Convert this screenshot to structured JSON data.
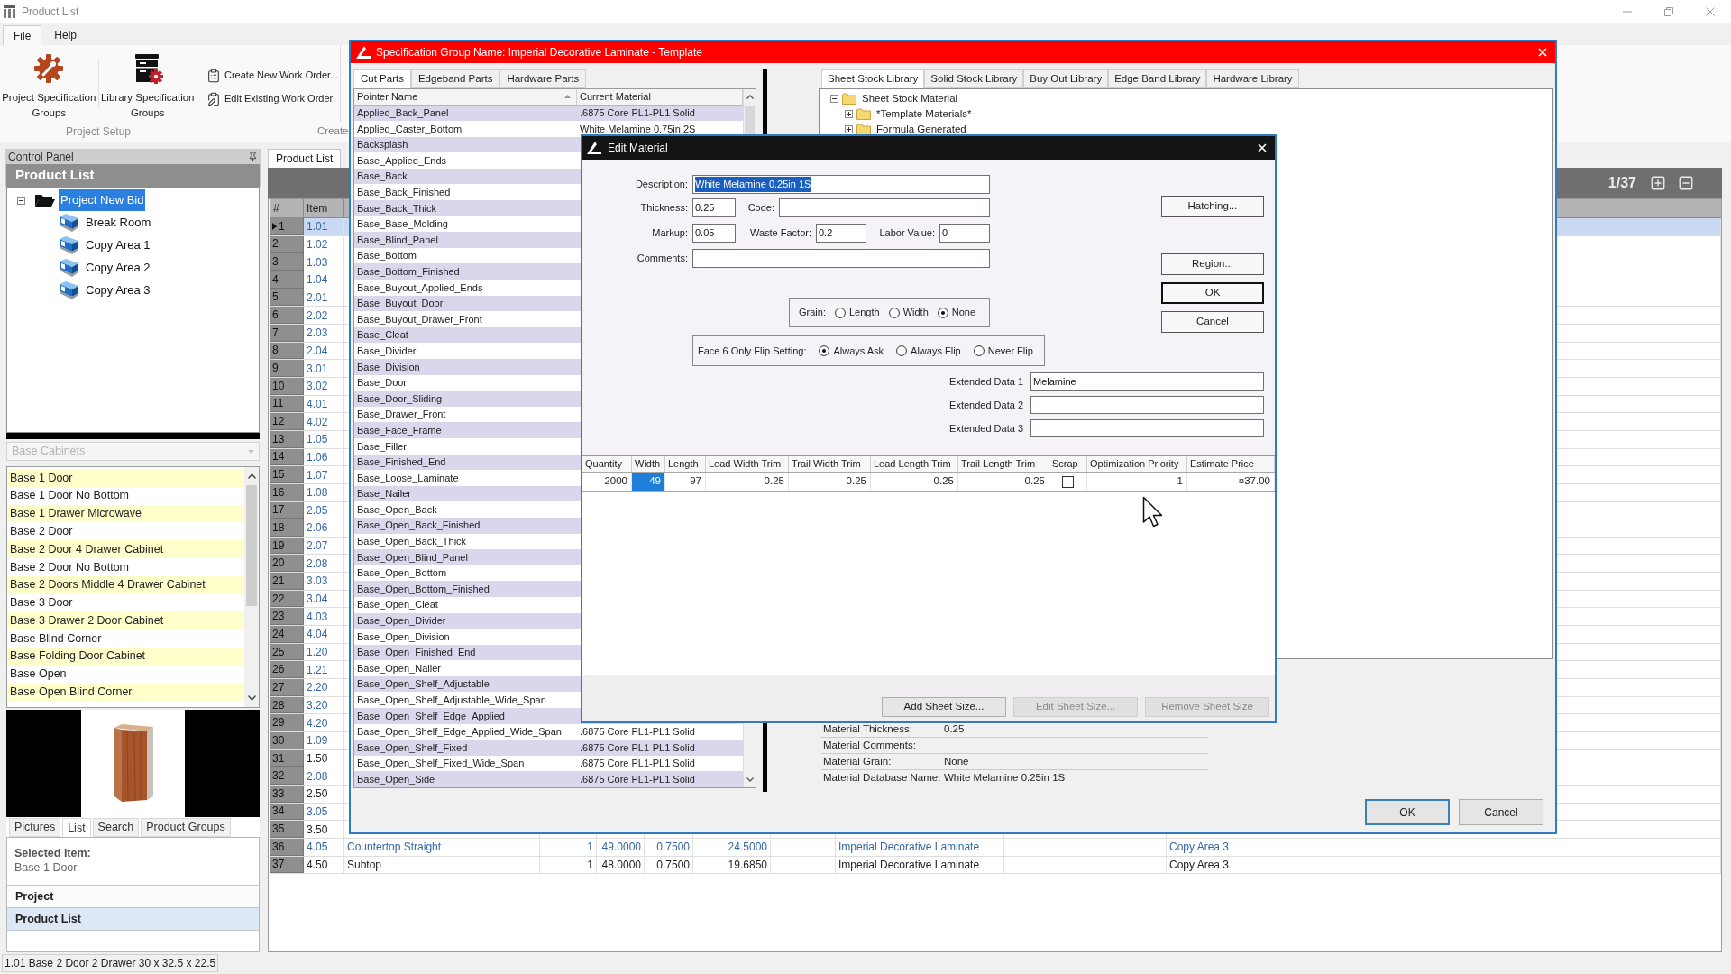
{
  "window": {
    "title": "Product List"
  },
  "menu_tabs": [
    {
      "label": "File",
      "selected": true
    },
    {
      "label": "Help",
      "selected": false
    }
  ],
  "ribbon": {
    "groups": [
      {
        "label": "Project Setup",
        "kind": "large",
        "buttons": [
          {
            "label": "Project Specification Groups"
          },
          {
            "label": "Library Specification Groups"
          }
        ]
      },
      {
        "label": "Create",
        "kind": "small",
        "buttons": [
          {
            "label": "Create New Work Order..."
          },
          {
            "label": "Edit Existing Work Order"
          }
        ]
      }
    ]
  },
  "control_panel": {
    "title": "Control Panel",
    "header": "Product List",
    "tree": {
      "label": "Project New Bid",
      "selected": true,
      "expanded": true,
      "children": [
        {
          "label": "Break Room",
          "selected": false
        },
        {
          "label": "Copy Area 1",
          "selected": false
        },
        {
          "label": "Copy Area 2",
          "selected": false
        },
        {
          "label": "Copy Area 3",
          "selected": false
        }
      ]
    },
    "category": {
      "value": "Base Cabinets",
      "disabled": true
    },
    "products": [
      "Base 1 Door",
      "Base 1 Door No Bottom",
      "Base 1 Drawer Microwave",
      "Base 2 Door",
      "Base 2 Door 4 Drawer Cabinet",
      "Base 2 Door No Bottom",
      "Base 2 Doors Middle 4 Drawer Cabinet",
      "Base 3 Door",
      "Base 3 Drawer 2 Door Cabinet",
      "Base Blind Corner",
      "Base Folding Door Cabinet",
      "Base Open",
      "Base Open Blind Corner"
    ],
    "view_tabs": [
      {
        "label": "Pictures",
        "selected": false
      },
      {
        "label": "List",
        "selected": true
      },
      {
        "label": "Search",
        "selected": false
      },
      {
        "label": "Product Groups",
        "selected": false
      }
    ],
    "selected_item": {
      "label": "Selected Item:",
      "value": "Base 1 Door"
    },
    "sections": [
      {
        "label": "Project",
        "selected": false
      },
      {
        "label": "Product List",
        "selected": true
      }
    ]
  },
  "main": {
    "tabs": [
      {
        "label": "Product List",
        "selected": true
      }
    ],
    "page": "1/37",
    "columns": [
      "#",
      "Item"
    ],
    "rows": [
      {
        "number": "1",
        "item": "1.01",
        "color": "#3565a5",
        "selected": true
      },
      {
        "number": "2",
        "item": "1.02",
        "color": "#3565a5",
        "selected": false
      },
      {
        "number": "3",
        "item": "1.03",
        "color": "#3565a5",
        "selected": false
      },
      {
        "number": "4",
        "item": "1.04",
        "color": "#3565a5",
        "selected": false
      },
      {
        "number": "5",
        "item": "2.01",
        "color": "#3565a5",
        "selected": false
      },
      {
        "number": "6",
        "item": "2.02",
        "color": "#3565a5",
        "selected": false
      },
      {
        "number": "7",
        "item": "2.03",
        "color": "#3565a5",
        "selected": false
      },
      {
        "number": "8",
        "item": "2.04",
        "color": "#3565a5",
        "selected": false
      },
      {
        "number": "9",
        "item": "3.01",
        "color": "#3565a5",
        "selected": false
      },
      {
        "number": "10",
        "item": "3.02",
        "color": "#3565a5",
        "selected": false
      },
      {
        "number": "11",
        "item": "4.01",
        "color": "#3565a5",
        "selected": false
      },
      {
        "number": "12",
        "item": "4.02",
        "color": "#3565a5",
        "selected": false
      },
      {
        "number": "13",
        "item": "1.05",
        "color": "#3565a5",
        "selected": false
      },
      {
        "number": "14",
        "item": "1.06",
        "color": "#3565a5",
        "selected": false
      },
      {
        "number": "15",
        "item": "1.07",
        "color": "#3565a5",
        "selected": false
      },
      {
        "number": "16",
        "item": "1.08",
        "color": "#3565a5",
        "selected": false
      },
      {
        "number": "17",
        "item": "2.05",
        "color": "#3565a5",
        "selected": false
      },
      {
        "number": "18",
        "item": "2.06",
        "color": "#3565a5",
        "selected": false
      },
      {
        "number": "19",
        "item": "2.07",
        "color": "#3565a5",
        "selected": false
      },
      {
        "number": "20",
        "item": "2.08",
        "color": "#3565a5",
        "selected": false
      },
      {
        "number": "21",
        "item": "3.03",
        "color": "#3565a5",
        "selected": false
      },
      {
        "number": "22",
        "item": "3.04",
        "color": "#3565a5",
        "selected": false
      },
      {
        "number": "23",
        "item": "4.03",
        "color": "#3565a5",
        "selected": false
      },
      {
        "number": "24",
        "item": "4.04",
        "color": "#3565a5",
        "selected": false
      },
      {
        "number": "25",
        "item": "1.20",
        "color": "#3565a5",
        "selected": false
      },
      {
        "number": "26",
        "item": "1.21",
        "color": "#3565a5",
        "selected": false
      },
      {
        "number": "27",
        "item": "2.20",
        "color": "#3565a5",
        "selected": false
      },
      {
        "number": "28",
        "item": "3.20",
        "color": "#3565a5",
        "selected": false
      },
      {
        "number": "29",
        "item": "4.20",
        "color": "#3565a5",
        "selected": false
      },
      {
        "number": "30",
        "item": "1.09",
        "color": "#3565a5",
        "selected": false
      },
      {
        "number": "31",
        "item": "1.50",
        "color": "#222222",
        "selected": false
      },
      {
        "number": "32",
        "item": "2.08",
        "color": "#3565a5",
        "selected": false
      },
      {
        "number": "33",
        "item": "2.50",
        "color": "#222222",
        "selected": false
      },
      {
        "number": "34",
        "item": "3.05",
        "color": "#3565a5",
        "selected": false
      },
      {
        "number": "35",
        "item": "3.50",
        "color": "#222222",
        "selected": false
      },
      {
        "number": "36",
        "item": "4.05",
        "color": "#3565a5",
        "selected": false,
        "column_3": "Countertop Straight",
        "column_4": "1",
        "column_5": "49.0000",
        "column_6": "0.7500",
        "column_7": "24.5000",
        "column_9": "Imperial Decorative Laminate",
        "column_11": "Copy Area 3"
      },
      {
        "number": "37",
        "item": "4.50",
        "color": "#222222",
        "selected": false,
        "column_3": "Subtop",
        "column_4": "1",
        "column_5": "48.0000",
        "column_6": "0.7500",
        "column_7": "19.6850",
        "column_9": "Imperial Decorative Laminate",
        "column_11": "Copy Area 3"
      }
    ]
  },
  "specification_dialog": {
    "title": "Specification Group Name: Imperial Decorative Laminate - Template",
    "part_tabs": [
      {
        "label": "Cut Parts",
        "selected": true
      },
      {
        "label": "Edgeband Parts",
        "selected": false
      },
      {
        "label": "Hardware Parts",
        "selected": false
      }
    ],
    "columns": [
      {
        "label": "Pointer Name",
        "sorted": true
      },
      {
        "label": "Current Material",
        "sorted": false
      }
    ],
    "parts": [
      {
        "name": "Applied_Back_Panel",
        "material": ".6875 Core PL1-PL1 Solid"
      },
      {
        "name": "Applied_Caster_Bottom",
        "material": "White Melamine 0.75in 2S"
      },
      {
        "name": "Backsplash"
      },
      {
        "name": "Base_Applied_Ends"
      },
      {
        "name": "Base_Back"
      },
      {
        "name": "Base_Back_Finished"
      },
      {
        "name": "Base_Back_Thick"
      },
      {
        "name": "Base_Base_Molding"
      },
      {
        "name": "Base_Blind_Panel"
      },
      {
        "name": "Base_Bottom"
      },
      {
        "name": "Base_Bottom_Finished"
      },
      {
        "name": "Base_Buyout_Applied_Ends"
      },
      {
        "name": "Base_Buyout_Door"
      },
      {
        "name": "Base_Buyout_Drawer_Front"
      },
      {
        "name": "Base_Cleat"
      },
      {
        "name": "Base_Divider"
      },
      {
        "name": "Base_Division"
      },
      {
        "name": "Base_Door"
      },
      {
        "name": "Base_Door_Sliding"
      },
      {
        "name": "Base_Drawer_Front"
      },
      {
        "name": "Base_Face_Frame"
      },
      {
        "name": "Base_Filler"
      },
      {
        "name": "Base_Finished_End"
      },
      {
        "name": "Base_Loose_Laminate"
      },
      {
        "name": "Base_Nailer"
      },
      {
        "name": "Base_Open_Back"
      },
      {
        "name": "Base_Open_Back_Finished"
      },
      {
        "name": "Base_Open_Back_Thick"
      },
      {
        "name": "Base_Open_Blind_Panel"
      },
      {
        "name": "Base_Open_Bottom"
      },
      {
        "name": "Base_Open_Bottom_Finished"
      },
      {
        "name": "Base_Open_Cleat"
      },
      {
        "name": "Base_Open_Divider"
      },
      {
        "name": "Base_Open_Division"
      },
      {
        "name": "Base_Open_Finished_End"
      },
      {
        "name": "Base_Open_Nailer"
      },
      {
        "name": "Base_Open_Shelf_Adjustable"
      },
      {
        "name": "Base_Open_Shelf_Adjustable_Wide_Span"
      },
      {
        "name": "Base_Open_Shelf_Edge_Applied"
      },
      {
        "name": "Base_Open_Shelf_Edge_Applied_Wide_Span",
        "material": ".6875 Core PL1-PL1 Solid"
      },
      {
        "name": "Base_Open_Shelf_Fixed",
        "material": ".6875 Core PL1-PL1 Solid"
      },
      {
        "name": "Base_Open_Shelf_Fixed_Wide_Span",
        "material": ".6875 Core PL1-PL1 Solid"
      },
      {
        "name": "Base_Open_Side",
        "material": ".6875 Core PL1-PL1 Solid"
      }
    ],
    "library_tabs": [
      {
        "label": "Sheet Stock Library",
        "selected": true
      },
      {
        "label": "Solid Stock Library",
        "selected": false
      },
      {
        "label": "Buy Out Library",
        "selected": false
      },
      {
        "label": "Edge Band Library",
        "selected": false
      },
      {
        "label": "Hardware Library",
        "selected": false
      }
    ],
    "library_tree": {
      "label": "Sheet Stock Material",
      "expanded": true,
      "children": [
        {
          "label": "*Template Materials*",
          "expanded": false
        },
        {
          "label": "Formula Generated",
          "expanded": false
        }
      ]
    },
    "properties": [
      {
        "label": "Material Thickness:",
        "value": "0.25"
      },
      {
        "label": "Material Comments:"
      },
      {
        "label": "Material Grain:",
        "value": "None"
      },
      {
        "label": "Material Database Name:",
        "value": "White Melamine 0.25in 1S"
      }
    ],
    "buttons": [
      {
        "label": "OK",
        "default": true
      },
      {
        "label": "Cancel",
        "default": false
      }
    ]
  },
  "edit_material": {
    "title": "Edit Material",
    "description": {
      "label": "Description:",
      "value": "White Melamine 0.25in 1S",
      "highlighted": true
    },
    "thickness": {
      "label": "Thickness:",
      "value": "0.25"
    },
    "code": {
      "label": "Code:"
    },
    "markup": {
      "label": "Markup:",
      "value": "0.05"
    },
    "waste_factor": {
      "label": "Waste Factor:",
      "value": "0.2"
    },
    "labor_value": {
      "label": "Labor Value:",
      "value": "0"
    },
    "comments": {
      "label": "Comments:"
    },
    "side_buttons": [
      {
        "label": "Hatching...",
        "default": false
      },
      {
        "label": "Region...",
        "default": false
      },
      {
        "label": "OK",
        "default": true
      },
      {
        "label": "Cancel",
        "default": false
      }
    ],
    "grain": {
      "label": "Grain:",
      "options": [
        {
          "label": "Length",
          "selected": false
        },
        {
          "label": "Width",
          "selected": false
        },
        {
          "label": "None",
          "selected": true
        }
      ]
    },
    "flip_setting": {
      "label": "Face 6 Only Flip Setting:",
      "options": [
        {
          "label": "Always Ask",
          "selected": true
        },
        {
          "label": "Always Flip",
          "selected": false
        },
        {
          "label": "Never Flip",
          "selected": false
        }
      ]
    },
    "extended_data": [
      {
        "label": "Extended Data 1",
        "value": "Melamine"
      },
      {
        "label": "Extended Data 2"
      },
      {
        "label": "Extended Data 3"
      }
    ],
    "sheet_table": {
      "columns": [
        "Quantity",
        "Width",
        "Length",
        "Lead Width Trim",
        "Trail Width Trim",
        "Lead Length Trim",
        "Trail Length Trim",
        "Scrap",
        "Optimization Priority",
        "Estimate Price"
      ],
      "rows": [
        {
          "cells": [
            {
              "kind": "text",
              "value": "2000",
              "selected": false
            },
            {
              "kind": "text",
              "value": "49",
              "selected": true
            },
            {
              "kind": "text",
              "value": "97",
              "selected": false
            },
            {
              "kind": "text",
              "value": "0.25",
              "selected": false
            },
            {
              "kind": "text",
              "value": "0.25",
              "selected": false
            },
            {
              "kind": "text",
              "value": "0.25",
              "selected": false
            },
            {
              "kind": "text",
              "value": "0.25",
              "selected": false
            },
            {
              "kind": "checkbox",
              "checked": false
            },
            {
              "kind": "text",
              "value": "1",
              "selected": false
            },
            {
              "kind": "text",
              "value": "¤37.00",
              "selected": false
            }
          ]
        }
      ]
    },
    "bottom_buttons": [
      {
        "label": "Add Sheet Size...",
        "disabled": false
      },
      {
        "label": "Edit Sheet Size...",
        "disabled": true
      },
      {
        "label": "Remove Sheet Size",
        "disabled": true
      }
    ]
  },
  "status_bar": {
    "text": "1.01 Base 2 Door 2 Drawer 30 x 32.5 x 22.5"
  }
}
